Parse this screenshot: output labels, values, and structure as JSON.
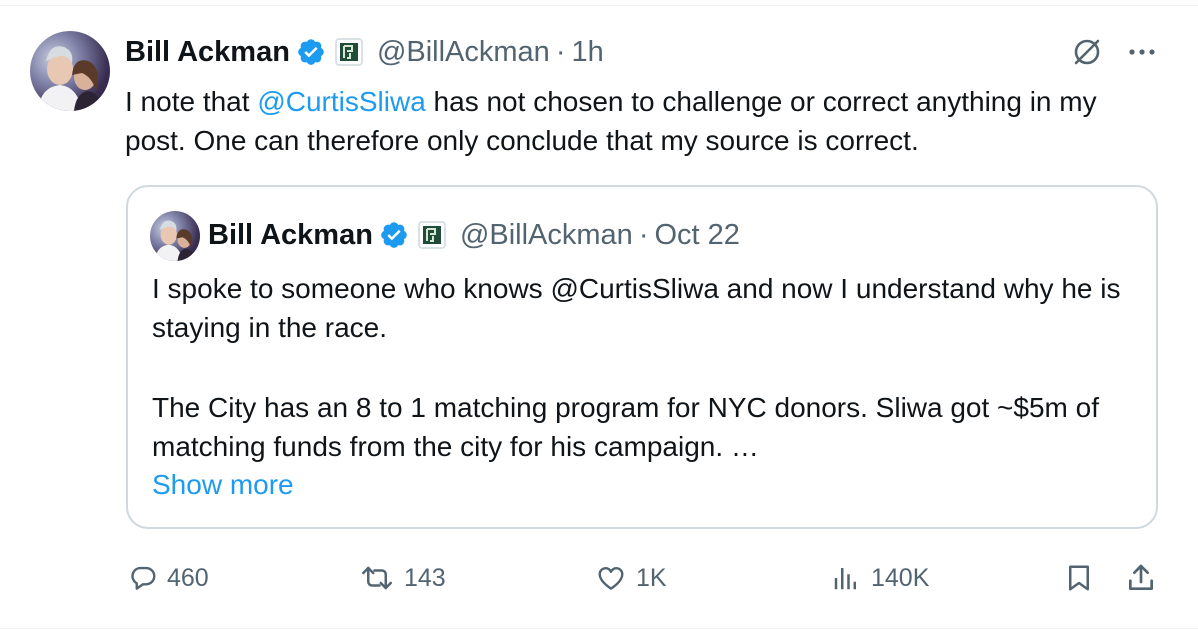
{
  "tweet": {
    "author_name": "Bill Ackman",
    "handle": "@BillAckman",
    "separator": "·",
    "time": "1h",
    "text_before": "I note that ",
    "mention": "@CurtisSliwa",
    "text_after": " has not chosen to challenge or correct anything in my post. One can therefore only conclude that my source is correct."
  },
  "quoted": {
    "author_name": "Bill Ackman",
    "handle": "@BillAckman",
    "separator": "·",
    "time": "Oct 22",
    "paragraph1": "I spoke to someone who knows @CurtisSliwa and now I understand why he is staying in the race.",
    "paragraph2": "The City has an 8 to 1 matching program for NYC donors.  Sliwa got ~$5m of matching funds from the city for his campaign. …",
    "show_more": "Show more"
  },
  "actions": {
    "replies": "460",
    "reposts": "143",
    "likes": "1K",
    "views": "140K"
  },
  "colors": {
    "accent": "#1d9bf0",
    "muted": "#536471",
    "text": "#0f1419",
    "border": "#cfd9de",
    "affiliate_badge_bg": "#1f4d3a"
  },
  "icons": [
    "verified-badge-icon",
    "affiliate-badge-icon",
    "grok-icon",
    "more-icon",
    "reply-icon",
    "repost-icon",
    "like-icon",
    "views-icon",
    "bookmark-icon",
    "share-icon"
  ]
}
